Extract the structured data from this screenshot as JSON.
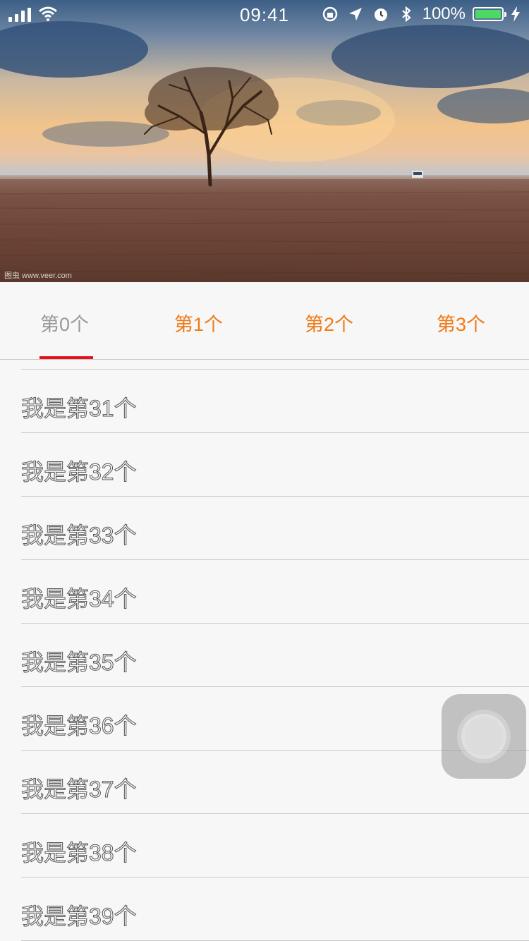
{
  "status_bar": {
    "time": "09:41",
    "battery_percent": "100%",
    "battery_level": 1.0,
    "battery_color": "#4cd964"
  },
  "hero": {
    "watermark": "图虫 www.veer.com",
    "icon": "landscape-photo"
  },
  "tabs": [
    {
      "label": "第0个",
      "active": true
    },
    {
      "label": "第1个",
      "active": false
    },
    {
      "label": "第2个",
      "active": false
    },
    {
      "label": "第3个",
      "active": false
    }
  ],
  "colors": {
    "tab_active": "#9a9a9a",
    "tab_inactive": "#f07a17",
    "indicator": "#e8101a"
  },
  "list": {
    "items": [
      {
        "label": "我是第31个"
      },
      {
        "label": "我是第32个"
      },
      {
        "label": "我是第33个"
      },
      {
        "label": "我是第34个"
      },
      {
        "label": "我是第35个"
      },
      {
        "label": "我是第36个"
      },
      {
        "label": "我是第37个"
      },
      {
        "label": "我是第38个"
      },
      {
        "label": "我是第39个"
      }
    ]
  },
  "assistive_touch": {
    "icon": "assistive-touch-icon"
  }
}
